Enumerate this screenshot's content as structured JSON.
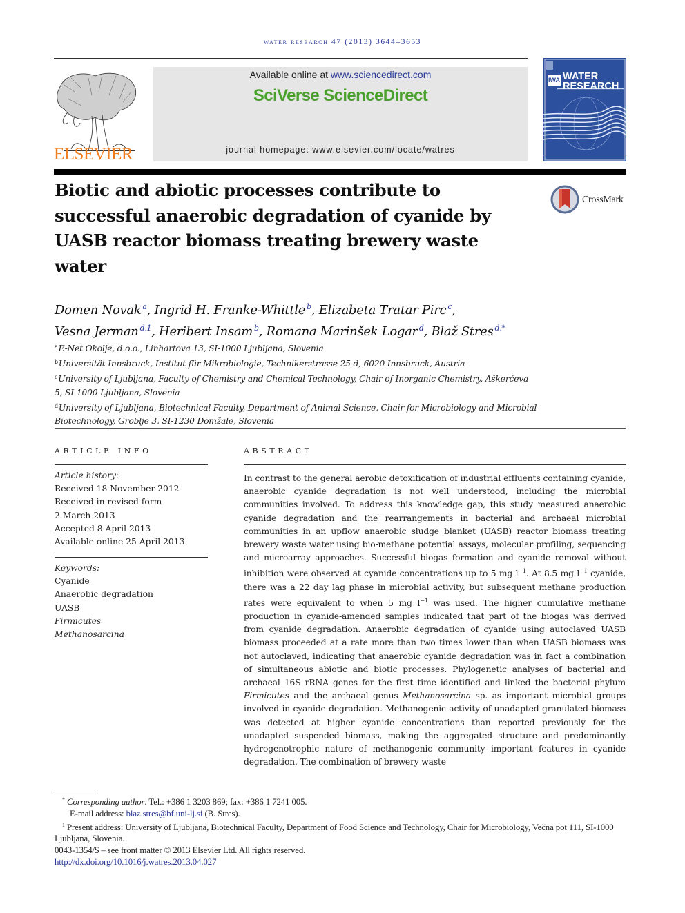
{
  "running_header": "water research 47 (2013) 3644–3653",
  "masthead": {
    "publisher_wordmark": "ELSEVIER",
    "available_online_prefix": "Available online at ",
    "available_online_link": "www.sciencedirect.com",
    "brand": "SciVerse ScienceDirect",
    "homepage_label": "journal homepage: www.elsevier.com/locate/watres",
    "cover": {
      "iwa_label": "IWA",
      "title_line1": "WATER",
      "title_line2": "RESEARCH"
    },
    "colors": {
      "elsevier_orange": "#f07d1e",
      "sciverse_green": "#4aa02c",
      "cover_blue": "#2c4f9e",
      "link_blue": "#2a3a9a"
    }
  },
  "article": {
    "title": "Biotic and abiotic processes contribute to successful anaerobic degradation of cyanide by UASB reactor biomass treating brewery waste water",
    "crossmark_label": "CrossMark",
    "authors": [
      {
        "name": "Domen Novak",
        "sup": "a",
        "sep": ", "
      },
      {
        "name": "Ingrid H. Franke-Whittle",
        "sup": "b",
        "sep": ", "
      },
      {
        "name": "Elizabeta Tratar Pirc",
        "sup": "c",
        "sep": ","
      },
      {
        "name": "Vesna Jerman",
        "sup": "d,1",
        "sep": ", "
      },
      {
        "name": "Heribert Insam",
        "sup": "b",
        "sep": ", "
      },
      {
        "name": "Romana Marinšek Logar",
        "sup": "d",
        "sep": ", "
      },
      {
        "name": "Blaž Stres",
        "sup": "d,*",
        "sep": ""
      }
    ],
    "affiliations": [
      {
        "key": "a",
        "text": "E-Net Okolje, d.o.o., Linhartova 13, SI-1000 Ljubljana, Slovenia"
      },
      {
        "key": "b",
        "text": "Universität Innsbruck, Institut für Mikrobiologie, Technikerstrasse 25 d, 6020 Innsbruck, Austria"
      },
      {
        "key": "c",
        "text": "University of Ljubljana, Faculty of Chemistry and Chemical Technology, Chair of Inorganic Chemistry, Aškerčeva 5, SI-1000 Ljubljana, Slovenia"
      },
      {
        "key": "d",
        "text": "University of Ljubljana, Biotechnical Faculty, Department of Animal Science, Chair for Microbiology and Microbial Biotechnology, Groblje 3, SI-1230 Domžale, Slovenia"
      }
    ]
  },
  "article_info": {
    "heading": "ARTICLE INFO",
    "history_label": "Article history:",
    "history": [
      "Received 18 November 2012",
      "Received in revised form",
      "2 March 2013",
      "Accepted 8 April 2013",
      "Available online 25 April 2013"
    ],
    "keywords_label": "Keywords:",
    "keywords": [
      {
        "text": "Cyanide",
        "italic": false
      },
      {
        "text": "Anaerobic degradation",
        "italic": false
      },
      {
        "text": "UASB",
        "italic": false
      },
      {
        "text": "Firmicutes",
        "italic": true
      },
      {
        "text": "Methanosarcina",
        "italic": true
      }
    ]
  },
  "abstract": {
    "heading": "ABSTRACT",
    "p1": "In contrast to the general aerobic detoxification of industrial effluents containing cyanide, anaerobic cyanide degradation is not well understood, including the microbial communities involved. To address this knowledge gap, this study measured anaerobic cyanide degradation and the rearrangements in bacterial and archaeal microbial communities in an upflow anaerobic sludge blanket (UASB) reactor biomass treating brewery waste water using bio-methane potential assays, molecular profiling, sequencing and microarray approaches. Successful biogas formation and cyanide removal without inhibition were observed at cyanide concentrations up to 5 mg l",
    "sup1": "−1",
    "p2": ". At 8.5 mg l",
    "sup2": "−1",
    "p3": " cyanide, there was a 22 day lag phase in microbial activity, but subsequent methane production rates were equivalent to when 5 mg l",
    "sup3": "−1",
    "p4": " was used. The higher cumulative methane production in cyanide-amended samples indicated that part of the biogas was derived from cyanide degradation. Anaerobic degradation of cyanide using autoclaved UASB biomass proceeded at a rate more than two times lower than when UASB biomass was not autoclaved, indicating that anaerobic cyanide degradation was in fact a combination of simultaneous abiotic and biotic processes. Phylogenetic analyses of bacterial and archaeal 16S rRNA genes for the first time identified and linked the bacterial phylum ",
    "italic1": "Firmicutes",
    "p5": " and the archaeal genus ",
    "italic2": "Methanosarcina",
    "p6": " sp. as important microbial groups involved in cyanide degradation. Methanogenic activity of unadapted granulated biomass was detected at higher cyanide concentrations than reported previously for the unadapted suspended biomass, making the aggregated structure and predominantly hydrogenotrophic nature of methanogenic community important features in cyanide degradation. The combination of brewery waste"
  },
  "footnotes": {
    "corresponding_mark": "*",
    "corresponding_label": "Corresponding author",
    "corresponding_contact": ". Tel.: +386 1 3203 869; fax: +386 1 7241 005.",
    "email_label": "E-mail address: ",
    "email": "blaz.stres@bf.uni-lj.si",
    "email_suffix": " (B. Stres).",
    "present_mark": "1",
    "present_address": " Present address: University of Ljubljana, Biotechnical Faculty, Department of Food Science and Technology, Chair for Microbiology, Večna pot 111, SI-1000 Ljubljana, Slovenia.",
    "copyright": "0043-1354/$ – see front matter © 2013 Elsevier Ltd. All rights reserved.",
    "doi": "http://dx.doi.org/10.1016/j.watres.2013.04.027"
  }
}
